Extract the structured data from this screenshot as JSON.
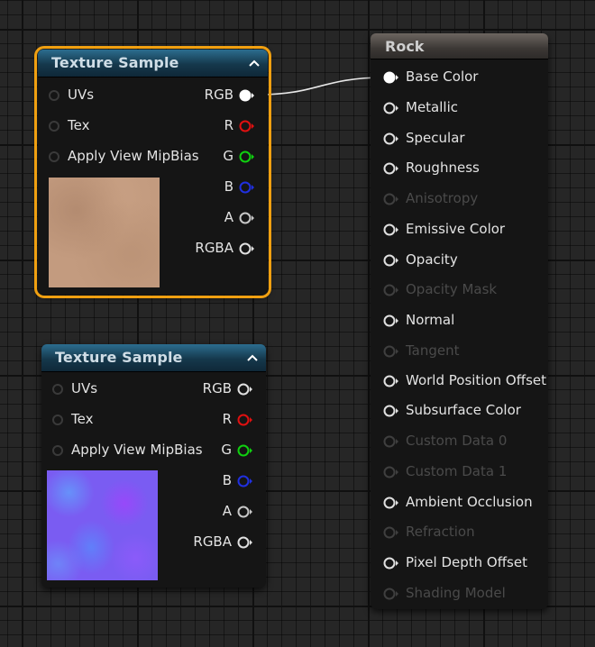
{
  "nodes": [
    {
      "title": "Texture Sample",
      "selected": true,
      "inputs": [
        {
          "label": "UVs"
        },
        {
          "label": "Tex"
        },
        {
          "label": "Apply View MipBias"
        }
      ],
      "outputs": [
        {
          "label": "RGB",
          "color": "#ffffff",
          "connected": true
        },
        {
          "label": "R",
          "color": "#e01010",
          "connected": false
        },
        {
          "label": "G",
          "color": "#10d010",
          "connected": false
        },
        {
          "label": "B",
          "color": "#2030e0",
          "connected": false
        },
        {
          "label": "A",
          "color": "#c8c8c8",
          "connected": false
        },
        {
          "label": "RGBA",
          "color": "#e0e0e0",
          "connected": false
        }
      ],
      "preview": "rock-albedo-texture"
    },
    {
      "title": "Texture Sample",
      "selected": false,
      "inputs": [
        {
          "label": "UVs"
        },
        {
          "label": "Tex"
        },
        {
          "label": "Apply View MipBias"
        }
      ],
      "outputs": [
        {
          "label": "RGB",
          "color": "#e0e0e0",
          "connected": false
        },
        {
          "label": "R",
          "color": "#e01010",
          "connected": false
        },
        {
          "label": "G",
          "color": "#10d010",
          "connected": false
        },
        {
          "label": "B",
          "color": "#2030e0",
          "connected": false
        },
        {
          "label": "A",
          "color": "#c8c8c8",
          "connected": false
        },
        {
          "label": "RGBA",
          "color": "#e0e0e0",
          "connected": false
        }
      ],
      "preview": "rock-normal-texture"
    }
  ],
  "material": {
    "title": "Rock",
    "pins": [
      {
        "label": "Base Color",
        "enabled": true,
        "connected": true
      },
      {
        "label": "Metallic",
        "enabled": true,
        "connected": false
      },
      {
        "label": "Specular",
        "enabled": true,
        "connected": false
      },
      {
        "label": "Roughness",
        "enabled": true,
        "connected": false
      },
      {
        "label": "Anisotropy",
        "enabled": false,
        "connected": false
      },
      {
        "label": "Emissive Color",
        "enabled": true,
        "connected": false
      },
      {
        "label": "Opacity",
        "enabled": true,
        "connected": false
      },
      {
        "label": "Opacity Mask",
        "enabled": false,
        "connected": false
      },
      {
        "label": "Normal",
        "enabled": true,
        "connected": false
      },
      {
        "label": "Tangent",
        "enabled": false,
        "connected": false
      },
      {
        "label": "World Position Offset",
        "enabled": true,
        "connected": false
      },
      {
        "label": "Subsurface Color",
        "enabled": true,
        "connected": false
      },
      {
        "label": "Custom Data 0",
        "enabled": false,
        "connected": false
      },
      {
        "label": "Custom Data 1",
        "enabled": false,
        "connected": false
      },
      {
        "label": "Ambient Occlusion",
        "enabled": true,
        "connected": false
      },
      {
        "label": "Refraction",
        "enabled": false,
        "connected": false
      },
      {
        "label": "Pixel Depth Offset",
        "enabled": true,
        "connected": false
      },
      {
        "label": "Shading Model",
        "enabled": false,
        "connected": false
      }
    ]
  },
  "colors": {
    "selection": "#f0a011",
    "node_header": "#1f5470",
    "material_header": "#5a534e",
    "wire": "#ffffff"
  }
}
